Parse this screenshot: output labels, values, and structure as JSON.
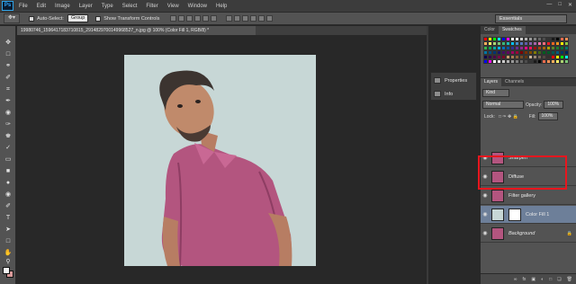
{
  "menu": [
    "File",
    "Edit",
    "Image",
    "Layer",
    "Type",
    "Select",
    "Filter",
    "View",
    "Window",
    "Help"
  ],
  "logo": "Ps",
  "options": {
    "auto_select_label": "Auto-Select:",
    "auto_select_value": "Group",
    "show_transform": "Show Transform Controls"
  },
  "workspace": "Essentials",
  "document_tab": "19980746_1596417183710815_2914829700149968527_n.jpg @ 100% (Color Fill 1, RGB/8) *",
  "panels": {
    "color_tab": "Color",
    "swatches_tab": "Swatches",
    "layers_tab": "Layers",
    "channels_tab": "Channels",
    "properties": "Properties",
    "info": "Info"
  },
  "layer_controls": {
    "kind": "Kind",
    "blend_mode": "Normal",
    "opacity_label": "Opacity:",
    "opacity_value": "100%",
    "lock_label": "Lock:",
    "fill_label": "Fill:",
    "fill_value": "100%"
  },
  "layers": [
    {
      "name": "Sharpen"
    },
    {
      "name": "Diffuse"
    },
    {
      "name": "Filter gallery"
    },
    {
      "name": "Color Fill 1"
    },
    {
      "name": "Background"
    }
  ],
  "colors": {
    "highlight": "#e8161e",
    "canvas_bg": "#c7d7d6",
    "shirt": "#b3557f"
  }
}
